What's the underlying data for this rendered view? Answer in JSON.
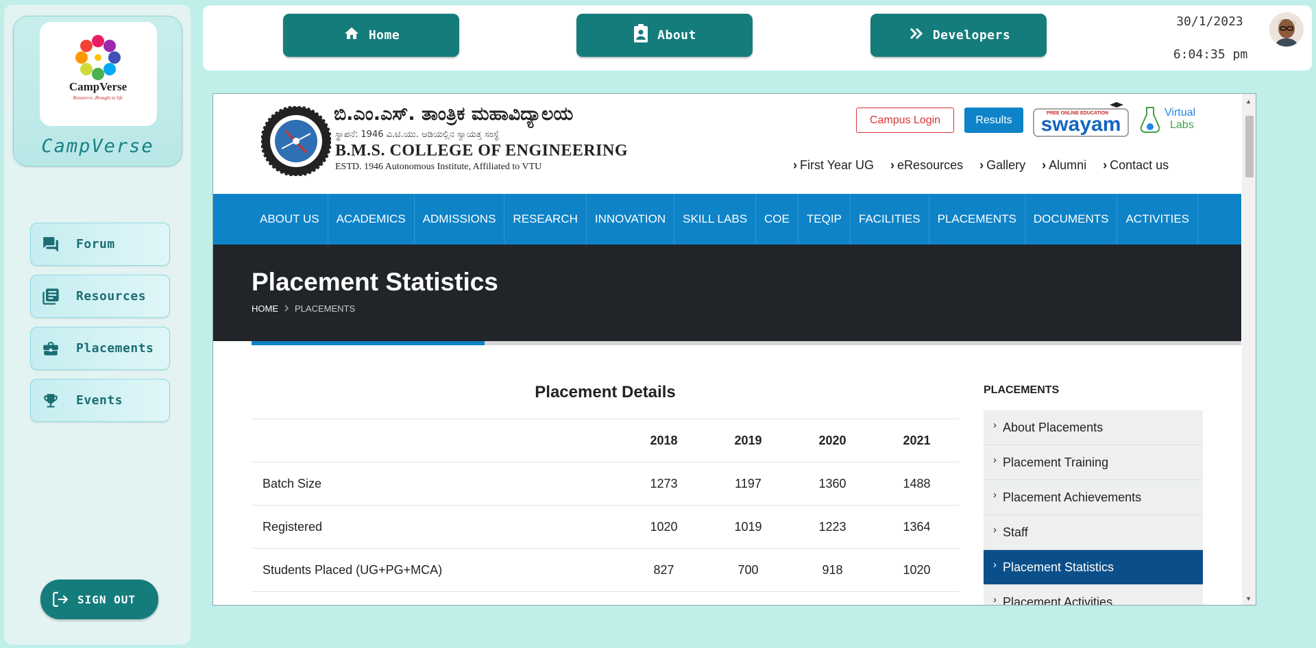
{
  "app": {
    "brand": "CampVerse",
    "logo_text": "CampVerse",
    "logo_tagline": "Resources ,Brought to life"
  },
  "sidebar": {
    "items": [
      {
        "label": "Forum",
        "icon": "forum-icon"
      },
      {
        "label": "Resources",
        "icon": "library-books-icon"
      },
      {
        "label": "Placements",
        "icon": "briefcase-icon"
      },
      {
        "label": "Events",
        "icon": "trophy-icon"
      }
    ],
    "signout_label": "SIGN OUT"
  },
  "topbar": {
    "buttons": [
      {
        "label": "Home",
        "icon": "home-icon"
      },
      {
        "label": "About",
        "icon": "contact-card-icon"
      },
      {
        "label": "Developers",
        "icon": "double-chevron-right-icon"
      }
    ],
    "date": "30/1/2023",
    "time": "6:04:35 pm"
  },
  "site": {
    "kannada_title": "ಬಿ.ಎಂ.ಎಸ್. ತಾಂತ್ರಿಕ ಮಹಾವಿದ್ಯಾಲಯ",
    "kannada_sub": "ಸ್ಥಾಪನೆ: 1946  ವಿ.ಟಿ.ಯು. ಅಡಿಯಲ್ಲಿನ ಸ್ವಾಯತ್ತ ಸಂಸ್ಥೆ",
    "college_name": "B.M.S. COLLEGE OF ENGINEERING",
    "estd": "ESTD. 1946  Autonomous Institute, Affiliated to VTU",
    "campus_login": "Campus Login",
    "results": "Results",
    "swayam_tag": "FREE ONLINE EDUCATION",
    "swayam": "swayam",
    "vlabs_line1": "Virtual",
    "vlabs_line2": "Labs",
    "top_links": [
      "First Year UG",
      "eResources",
      "Gallery",
      "Alumni",
      "Contact us"
    ],
    "nav": [
      "ABOUT US",
      "ACADEMICS",
      "ADMISSIONS",
      "RESEARCH",
      "INNOVATION",
      "SKILL LABS",
      "COE",
      "TEQIP",
      "FACILITIES",
      "PLACEMENTS",
      "DOCUMENTS",
      "ACTIVITIES"
    ],
    "banner_title": "Placement Statistics",
    "breadcrumb_home": "HOME",
    "breadcrumb_current": "PLACEMENTS",
    "content_title": "Placement Details",
    "table": {
      "years": [
        "2018",
        "2019",
        "2020",
        "2021"
      ],
      "rows": [
        {
          "label": "Batch Size",
          "values": [
            "1273",
            "1197",
            "1360",
            "1488"
          ]
        },
        {
          "label": "Registered",
          "values": [
            "1020",
            "1019",
            "1223",
            "1364"
          ]
        },
        {
          "label": "Students Placed (UG+PG+MCA)",
          "values": [
            "827",
            "700",
            "918",
            "1020"
          ]
        }
      ]
    },
    "aside_title": "PLACEMENTS",
    "aside_items": [
      "About Placements",
      "Placement Training",
      "Placement Achievements",
      "Staff",
      "Placement Statistics",
      "Placement Activities"
    ],
    "aside_active": 4
  },
  "colors": {
    "teal": "#157c7c",
    "page_bg": "#c0efea",
    "site_blue": "#0e83c8",
    "aside_active": "#0b4f8a",
    "banner": "#212529"
  }
}
